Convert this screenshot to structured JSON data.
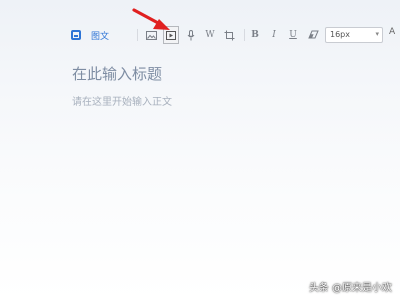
{
  "toolbar": {
    "type_label": "图文",
    "font_size": "16px",
    "font_color_label": "A",
    "items": [
      {
        "icon": "image-icon",
        "label": ""
      },
      {
        "icon": "video-icon",
        "label": ""
      },
      {
        "icon": "microphone-icon",
        "label": ""
      },
      {
        "icon": "word-icon",
        "label": "W"
      },
      {
        "icon": "crop-icon",
        "label": ""
      },
      {
        "icon": "bold-icon",
        "label": "B"
      },
      {
        "icon": "italic-icon",
        "label": "I"
      },
      {
        "icon": "underline-icon",
        "label": "U"
      },
      {
        "icon": "eraser-icon",
        "label": ""
      }
    ]
  },
  "editor": {
    "title_placeholder": "在此输入标题",
    "body_placeholder": "请在这里开始输入正文"
  },
  "watermark": {
    "text": "头条 @原来是小欢"
  },
  "colors": {
    "accent": "#2d74d6",
    "arrow": "#e02020",
    "title_placeholder": "#7e8da3",
    "body_placeholder": "#a8b1bd"
  }
}
